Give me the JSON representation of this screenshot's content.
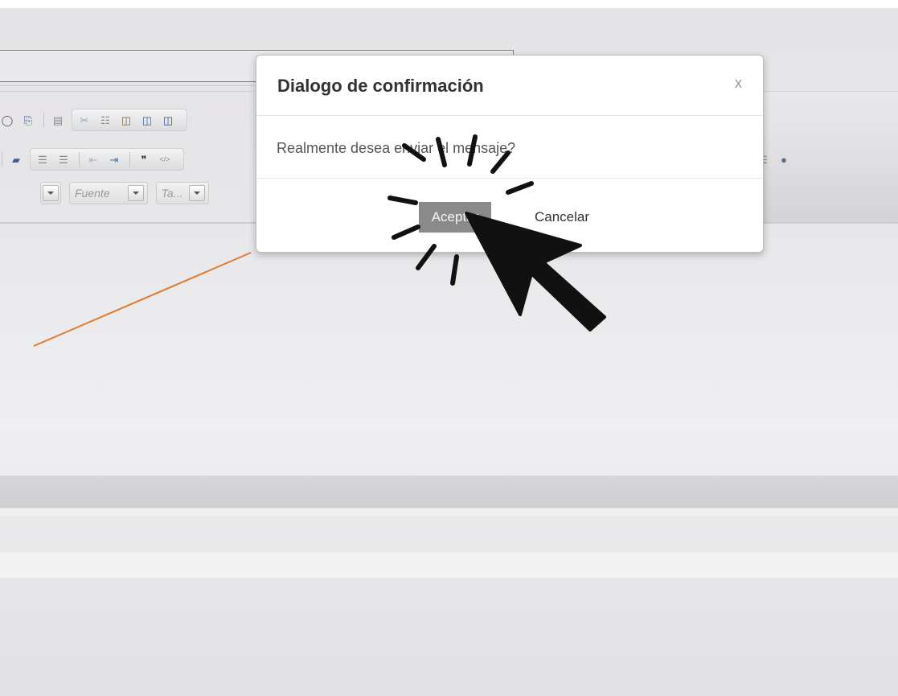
{
  "editor": {
    "toolbar_row1_icons": [
      "binoculars-icon",
      "print-icon",
      "templates-icon",
      "cut-icon",
      "copy-icon",
      "paste-icon",
      "paste-text-icon",
      "paste-word-icon"
    ],
    "toolbar_row2_icons": [
      "eraser-icon",
      "numbered-list-icon",
      "bulleted-list-icon",
      "outdent-icon",
      "indent-icon",
      "blockquote-icon",
      "div-icon"
    ],
    "toolbar_right_icons": [
      "table-icon",
      "globe-icon"
    ],
    "font_combo": "Fuente",
    "size_combo": "Ta..."
  },
  "dialog": {
    "title": "Dialogo de confirmación",
    "close": "x",
    "message": "Realmente desea enviar el mensaje?",
    "ok_label": "Aceptar",
    "cancel_label": "Cancelar"
  },
  "annotation": {
    "line_color": "#e07a2f",
    "cursor_color": "#111111"
  }
}
